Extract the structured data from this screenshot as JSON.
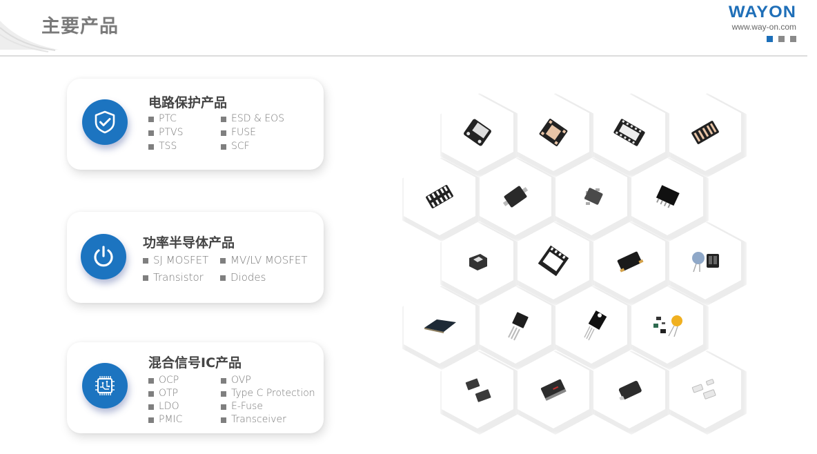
{
  "header": {
    "title": "主要产品",
    "logo": {
      "wordmark": "WAYON",
      "url": "www.way-on.com",
      "page_indicator": {
        "count": 3,
        "active_index": 0
      }
    }
  },
  "colors": {
    "brand_blue": "#1c74c0",
    "title_gray": "#7a7a7a",
    "bullet_gray": "#7f7f7f"
  },
  "categories": [
    {
      "id": "circuit-protection",
      "icon": "shield-check-icon",
      "title": "电路保护产品",
      "items": [
        "PTC",
        "ESD & EOS",
        "PTVS",
        "FUSE",
        "TSS",
        "SCF"
      ]
    },
    {
      "id": "power-semiconductor",
      "icon": "power-icon",
      "title": "功率半导体产品",
      "items": [
        "SJ MOSFET",
        "MV/LV MOSFET",
        "Transistor",
        "Diodes"
      ]
    },
    {
      "id": "mixed-signal-ic",
      "icon": "chip-icon",
      "title": "混合信号IC产品",
      "items": [
        "OCP",
        "OVP",
        "OTP",
        "Type C Protection",
        "LDO",
        "E-Fuse",
        "PMIC",
        "Transceiver"
      ]
    }
  ],
  "product_gallery": {
    "rows": [
      [
        "dfn-2pad-package",
        "dfn-6pad-copper-package",
        "dfn-10pin-package",
        "dfn-array-package"
      ],
      [
        "udfn-10pin-package",
        "sod-323-package",
        "sot-23-5-package",
        "sop-8-package"
      ],
      [
        "sot-cube-package",
        "pdfn-package",
        "smd-crystal-package",
        "varistor-and-connector"
      ],
      [
        "qfn-flat-package",
        "to-251-package",
        "to-220f-package",
        "chip-ptc-and-disc-varistor"
      ],
      [
        "sma-diodes-package",
        "smb-package",
        "smc-package",
        "chip-fuse-package"
      ]
    ]
  }
}
